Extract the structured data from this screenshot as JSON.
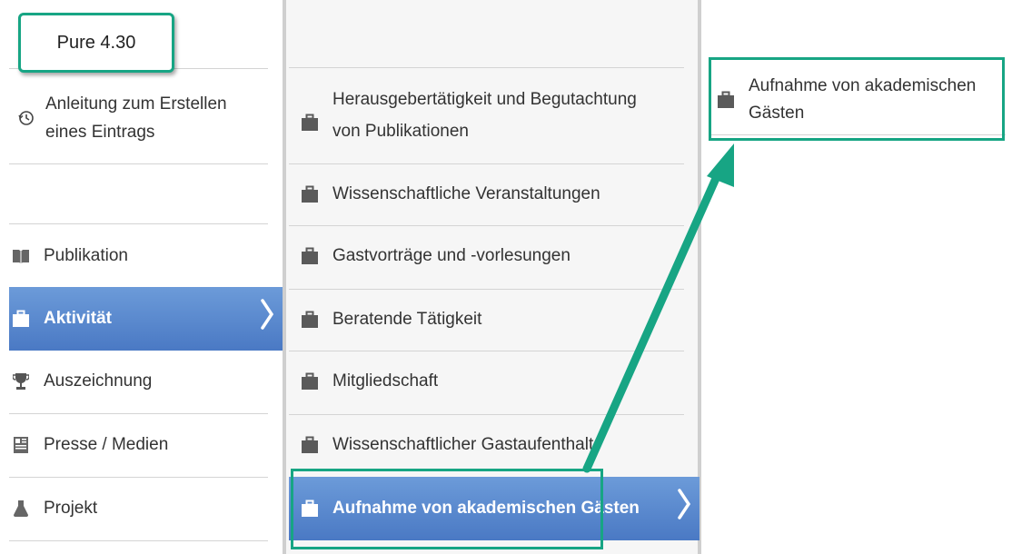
{
  "version_label": "Pure 4.30",
  "left_menu": {
    "guide": "Anleitung zum Erstellen eines Eintrags",
    "items": [
      {
        "label": "Publikation",
        "icon": "book-icon"
      },
      {
        "label": "Aktivität",
        "icon": "briefcase-icon"
      },
      {
        "label": "Auszeichnung",
        "icon": "trophy-icon"
      },
      {
        "label": "Presse / Medien",
        "icon": "newspaper-icon"
      },
      {
        "label": "Projekt",
        "icon": "flask-icon"
      }
    ]
  },
  "activity_menu": {
    "items": [
      "Herausgebertätigkeit und Begutachtung von Publikationen",
      "Wissenschaftliche Veranstaltungen",
      "Gastvorträge und -vorlesungen",
      "Beratende Tätigkeit",
      "Mitgliedschaft",
      "Wissenschaftlicher Gastaufenthalt",
      "Aufnahme von akademischen Gästen"
    ]
  },
  "sub_menu": {
    "items": [
      "Aufnahme von akademischen Gästen"
    ]
  },
  "colors": {
    "selected": "#5a87cf",
    "highlight": "#17a584",
    "icon": "#555555"
  }
}
